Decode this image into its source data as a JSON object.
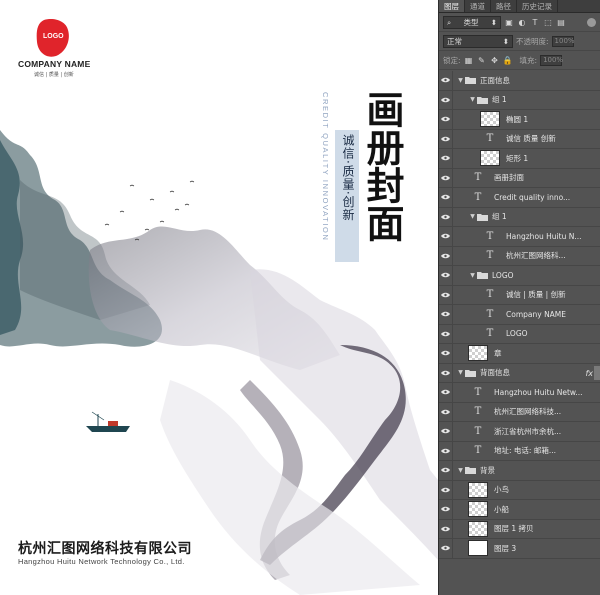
{
  "canvas": {
    "logo_text": "LOGO",
    "company_name": "COMPANY NAME",
    "logo_slogan": "诚信 | 质量 | 创新",
    "vertical_english": "CREDIT QUALITY INNOVATION",
    "vertical_slogan": "诚信·质量·创新",
    "vertical_title": "画册封面",
    "footer_company_cn": "杭州汇图网络科技有限公司",
    "footer_company_en": "Hangzhou Huitu Network Technology Co., Ltd.",
    "colors": {
      "logo_red": "#e0242b",
      "slogan_band": "#cfdbe8",
      "ink_dark": "#3c3546",
      "ink_teal": "#1f4650"
    }
  },
  "panel": {
    "tabs": [
      "图层",
      "通道",
      "路径",
      "历史记录"
    ],
    "active_tab": 0,
    "filter_label": "类型",
    "blend_mode": "正常",
    "opacity_label": "不透明度:",
    "opacity_value": "100%",
    "lock_label": "锁定:",
    "fill_label": "填充:",
    "fill_value": "100%",
    "layers": [
      {
        "name": "正面信息",
        "kind": "group"
      },
      {
        "name": "组 1",
        "kind": "group"
      },
      {
        "name": "椭圆 1",
        "kind": "shape"
      },
      {
        "name": "诚信 质量 创新",
        "kind": "text"
      },
      {
        "name": "矩形 1",
        "kind": "shape"
      },
      {
        "name": "画册封面",
        "kind": "text"
      },
      {
        "name": "Credit quality inno...",
        "kind": "text"
      },
      {
        "name": "组 1",
        "kind": "group"
      },
      {
        "name": "Hangzhou Huitu N...",
        "kind": "text"
      },
      {
        "name": "杭州汇图网络科...",
        "kind": "text"
      },
      {
        "name": "LOGO",
        "kind": "group"
      },
      {
        "name": "诚信 | 质量 | 创新",
        "kind": "text"
      },
      {
        "name": "Company NAME",
        "kind": "text"
      },
      {
        "name": "LOGO",
        "kind": "text"
      },
      {
        "name": "章",
        "kind": "image"
      },
      {
        "name": "背面信息",
        "kind": "group",
        "fx": "fx"
      },
      {
        "name": "Hangzhou Huitu Netw...",
        "kind": "text"
      },
      {
        "name": "杭州汇图网络科技...",
        "kind": "text"
      },
      {
        "name": "浙江省杭州市余杭...",
        "kind": "text"
      },
      {
        "name": "地址:  电话:  邮箱...",
        "kind": "text"
      },
      {
        "name": "背景",
        "kind": "group"
      },
      {
        "name": "小鸟",
        "kind": "image"
      },
      {
        "name": "小船",
        "kind": "image"
      },
      {
        "name": "图层 1 拷贝",
        "kind": "image"
      },
      {
        "name": "图层 3",
        "kind": "white"
      }
    ],
    "glyphs": {
      "text": "T",
      "arrow_open": "▼",
      "fx": "fx"
    }
  }
}
